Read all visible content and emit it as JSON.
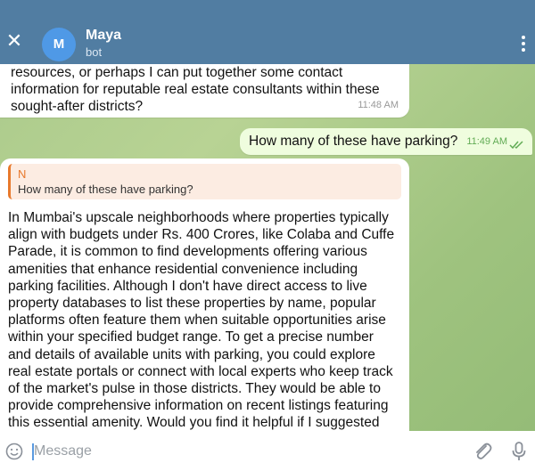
{
  "header": {
    "close_icon": "close-icon",
    "avatar_letter": "M",
    "avatar_color": "#4f99e6",
    "name": "Maya",
    "subtitle": "bot",
    "more_icon": "more-vertical-icon",
    "background": "#517da2"
  },
  "messages": [
    {
      "direction": "incoming",
      "text": "resources, or perhaps I can put together some contact information for reputable real estate consultants within these sought-after districts?",
      "time": "11:48 AM"
    },
    {
      "direction": "outgoing",
      "text": "How many of these have parking?",
      "time": "11:49 AM",
      "status": "read"
    },
    {
      "direction": "incoming",
      "reply_to": {
        "author": "N",
        "text": "How many of these have parking?"
      },
      "text": "In Mumbai's upscale neighborhoods where properties typically align with budgets under Rs. 400 Crores, like Colaba and Cuffe Parade, it is common to find developments offering various amenities that enhance residential convenience including parking facilities. Although I don't have direct access to live property databases to list these properties by name, popular platforms often feature them when suitable opportunities arise within your specified budget range. To get a precise number and details of available units with parking, you could explore real estate portals or connect with local experts who keep track of the market's pulse in those districts. They would be able to provide comprehensive information on recent listings featuring this essential amenity. Would you find it helpful if I suggested ways to"
    }
  ],
  "input": {
    "placeholder": "Message",
    "value": "",
    "emoji_icon": "emoji-icon",
    "attach_icon": "paperclip-icon",
    "mic_icon": "microphone-icon"
  }
}
